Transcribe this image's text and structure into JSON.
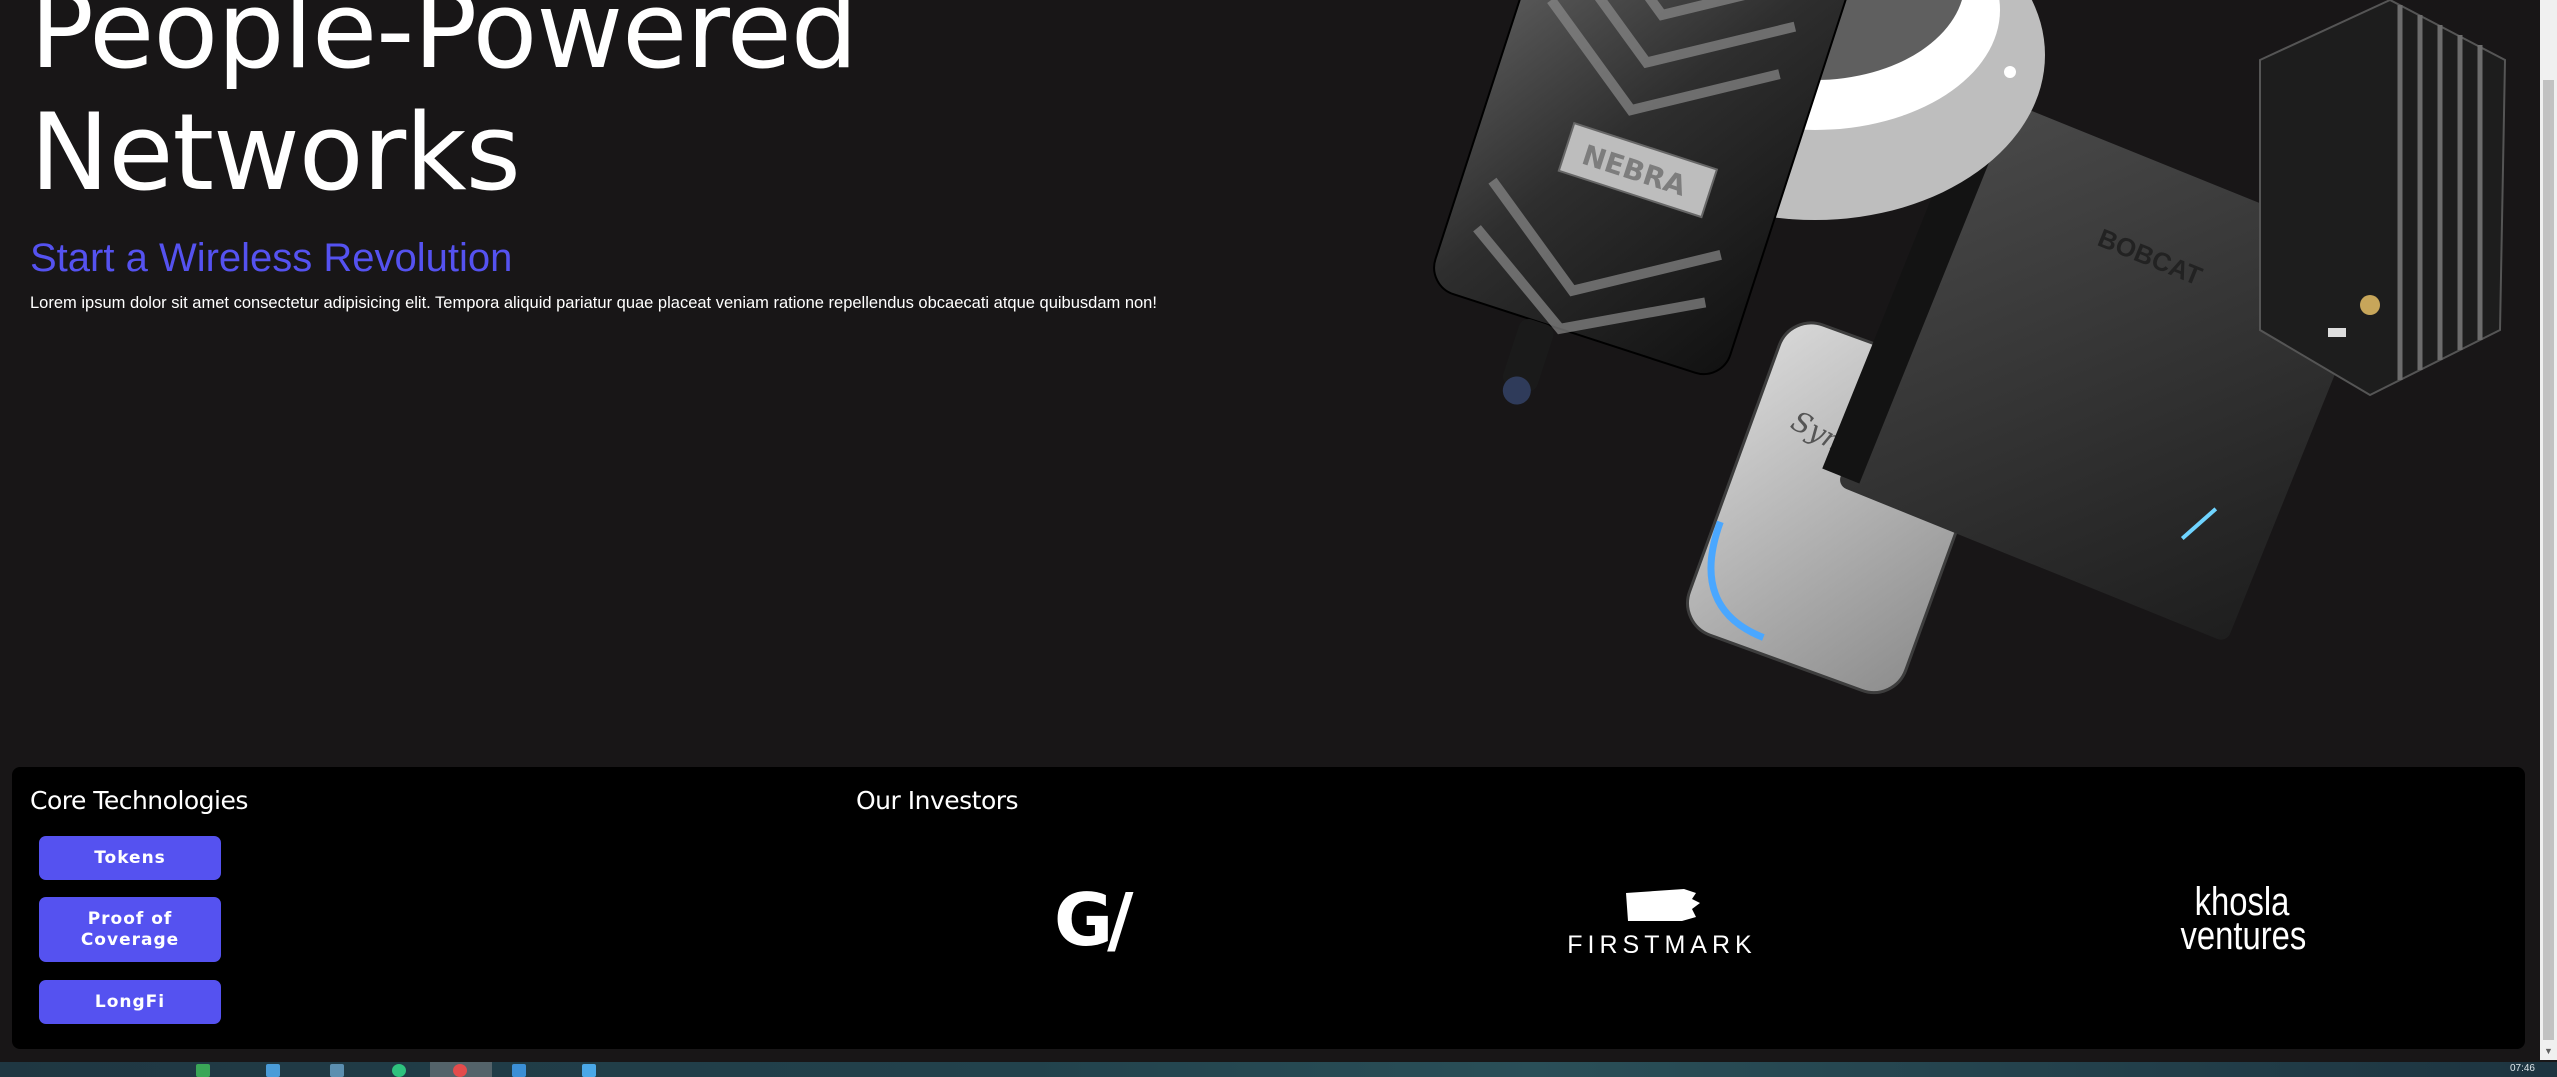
{
  "hero": {
    "title_line1": "People-Powered",
    "title_line2": "Networks",
    "subtitle": "Start a Wireless Revolution",
    "body": "Lorem ipsum dolor sit amet consectetur adipisicing elit. Tempora aliquid pariatur quae placeat veniam ratione repellendus obcaecati atque quibusdam non!"
  },
  "devices": {
    "nebra_label": "NEBRA",
    "bobcat_label": "BOBCAT",
    "synclabs_label": "SyncroBit"
  },
  "technologies": {
    "title": "Core Technologies",
    "buttons": [
      "Tokens",
      "Proof of Coverage",
      "LongFi"
    ]
  },
  "investors": {
    "title": "Our Investors",
    "gv": "G/",
    "firstmark": "FIRSTMARK",
    "khosla_line1": "khosla",
    "khosla_line2": "ventures"
  },
  "taskbar": {
    "clock": "07:46"
  },
  "colors": {
    "accent": "#5552f0",
    "background": "#181617",
    "panel": "#000000"
  }
}
